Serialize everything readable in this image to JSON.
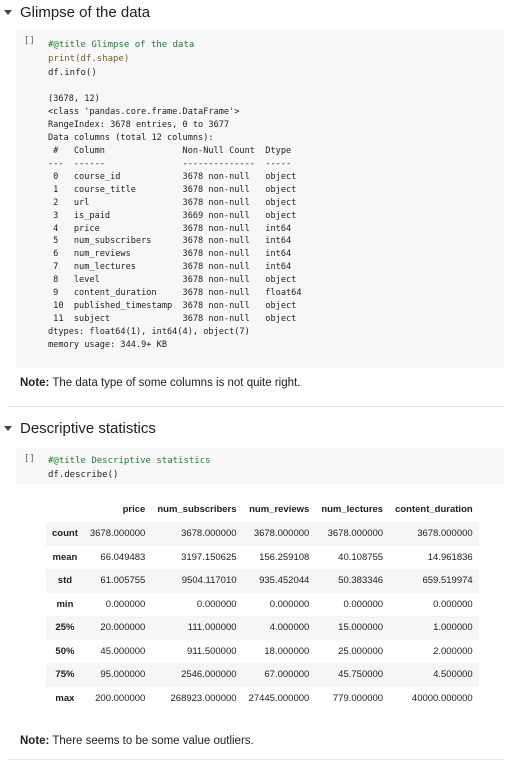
{
  "section1": {
    "title": "Glimpse of the data"
  },
  "cell1": {
    "run_icon": "[]",
    "lines": [
      "#@title Glimpse of the data",
      "print(df.shape)",
      "df.info()"
    ]
  },
  "output1": "(3678, 12)\n<class 'pandas.core.frame.DataFrame'>\nRangeIndex: 3678 entries, 0 to 3677\nData columns (total 12 columns):\n #   Column               Non-Null Count  Dtype  \n---  ------               --------------  -----  \n 0   course_id            3678 non-null   object \n 1   course_title         3678 non-null   object \n 2   url                  3678 non-null   object \n 3   is_paid              3669 non-null   object \n 4   price                3678 non-null   int64  \n 5   num_subscribers      3678 non-null   int64  \n 6   num_reviews          3678 non-null   int64  \n 7   num_lectures         3678 non-null   int64  \n 8   level                3678 non-null   object \n 9   content_duration     3678 non-null   float64\n 10  published_timestamp  3678 non-null   object \n 11  subject              3678 non-null   object \ndtypes: float64(1), int64(4), object(7)\nmemory usage: 344.9+ KB",
  "note1": {
    "bold": "Note:",
    "text": " The data type of some columns is not quite right."
  },
  "section2": {
    "title": "Descriptive statistics"
  },
  "cell2": {
    "run_icon": "[]",
    "lines": [
      "#@title Descriptive statistics",
      "df.describe()"
    ]
  },
  "table": {
    "columns": [
      "",
      "price",
      "num_subscribers",
      "num_reviews",
      "num_lectures",
      "content_duration"
    ],
    "rows": [
      [
        "count",
        "3678.000000",
        "3678.000000",
        "3678.000000",
        "3678.000000",
        "3678.000000"
      ],
      [
        "mean",
        "66.049483",
        "3197.150625",
        "156.259108",
        "40.108755",
        "14.961836"
      ],
      [
        "std",
        "61.005755",
        "9504.117010",
        "935.452044",
        "50.383346",
        "659.519974"
      ],
      [
        "min",
        "0.000000",
        "0.000000",
        "0.000000",
        "0.000000",
        "0.000000"
      ],
      [
        "25%",
        "20.000000",
        "111.000000",
        "4.000000",
        "15.000000",
        "1.000000"
      ],
      [
        "50%",
        "45.000000",
        "911.500000",
        "18.000000",
        "25.000000",
        "2.000000"
      ],
      [
        "75%",
        "95.000000",
        "2546.000000",
        "67.000000",
        "45.750000",
        "4.500000"
      ],
      [
        "max",
        "200.000000",
        "268923.000000",
        "27445.000000",
        "779.000000",
        "40000.000000"
      ]
    ]
  },
  "note2": {
    "bold": "Note:",
    "text": " There seems to be some value outliers."
  }
}
